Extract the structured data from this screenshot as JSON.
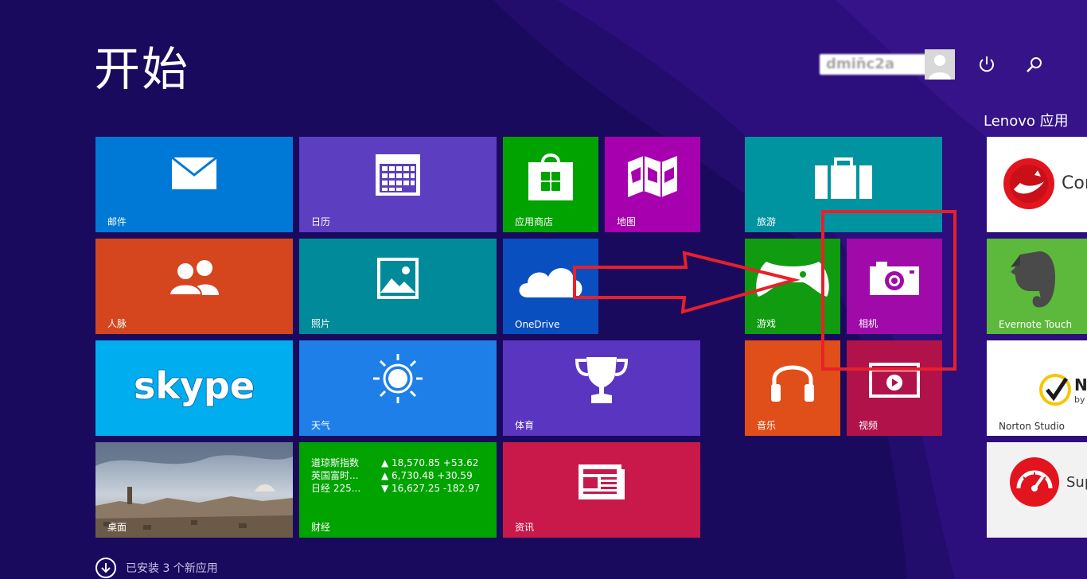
{
  "screen": {
    "title": "开始"
  },
  "user": {
    "name": "dmin̄c2a",
    "avatar_icon": "person-silhouette-icon"
  },
  "top_actions": {
    "power_icon": "power-icon",
    "search_icon": "search-icon"
  },
  "groups": {
    "right_group_label": "Lenovo 应用"
  },
  "tiles": {
    "mail": {
      "label": "邮件",
      "color": "#0079d6",
      "icon": "mail-icon"
    },
    "calendar": {
      "label": "日历",
      "color": "#5b3fc0",
      "icon": "calendar-icon"
    },
    "store": {
      "label": "应用商店",
      "color": "#00a300",
      "icon": "store-bag-icon"
    },
    "maps": {
      "label": "地图",
      "color": "#a700ae",
      "icon": "map-icon"
    },
    "travel": {
      "label": "旅游",
      "color": "#0093a0",
      "icon": "suitcase-icon"
    },
    "people": {
      "label": "人脉",
      "color": "#d5461f",
      "icon": "people-icon"
    },
    "photos": {
      "label": "照片",
      "color": "#008a9a",
      "icon": "photo-icon"
    },
    "onedrive": {
      "label": "OneDrive",
      "color": "#0a4fc0",
      "icon": "cloud-icon"
    },
    "games": {
      "label": "游戏",
      "color": "#109b10",
      "icon": "game-controller-icon"
    },
    "camera": {
      "label": "相机",
      "color": "#a00aa8",
      "icon": "camera-icon"
    },
    "skype": {
      "label": "skype",
      "color": "#00aef0",
      "icon": "skype-logo"
    },
    "weather": {
      "label": "天气",
      "color": "#1e7fe8",
      "icon": "sun-icon"
    },
    "sports": {
      "label": "体育",
      "color": "#5a35c0",
      "icon": "trophy-icon"
    },
    "music": {
      "label": "音乐",
      "color": "#e04e1a",
      "icon": "headphones-icon"
    },
    "video": {
      "label": "视频",
      "color": "#b2124a",
      "icon": "video-play-icon"
    },
    "desktop": {
      "label": "桌面",
      "color": "#6a7d99",
      "icon": "desktop-photo"
    },
    "finance": {
      "label": "财经",
      "color": "#00a300",
      "rows": [
        {
          "name": "道琼斯指数",
          "value": "▲ 18,570.85 +53.62"
        },
        {
          "name": "英国富时...",
          "value": "▲ 6,730.48 +30.59"
        },
        {
          "name": "日经 225...",
          "value": "▼ 16,627.25 -182.97"
        }
      ]
    },
    "news": {
      "label": "资讯",
      "color": "#c8194a",
      "icon": "newspaper-icon"
    },
    "lenovo_companion": {
      "label": "Cor",
      "color": "#ffffff",
      "icon": "lenovo-companion-icon"
    },
    "evernote": {
      "label": "Evernote Touch",
      "color": "#5db93b",
      "icon": "evernote-elephant-icon"
    },
    "norton": {
      "label": "Norton Studio",
      "partial": "N",
      "partial2": "by",
      "color": "#ffffff",
      "icon": "norton-check-icon"
    },
    "support": {
      "label": "Sup",
      "color": "#f2f2f2",
      "icon": "speedometer-icon"
    }
  },
  "footer": {
    "text": "已安装 3 个新应用",
    "icon": "down-arrow-circle-icon"
  },
  "annotation": {
    "color": "#e8202a"
  }
}
